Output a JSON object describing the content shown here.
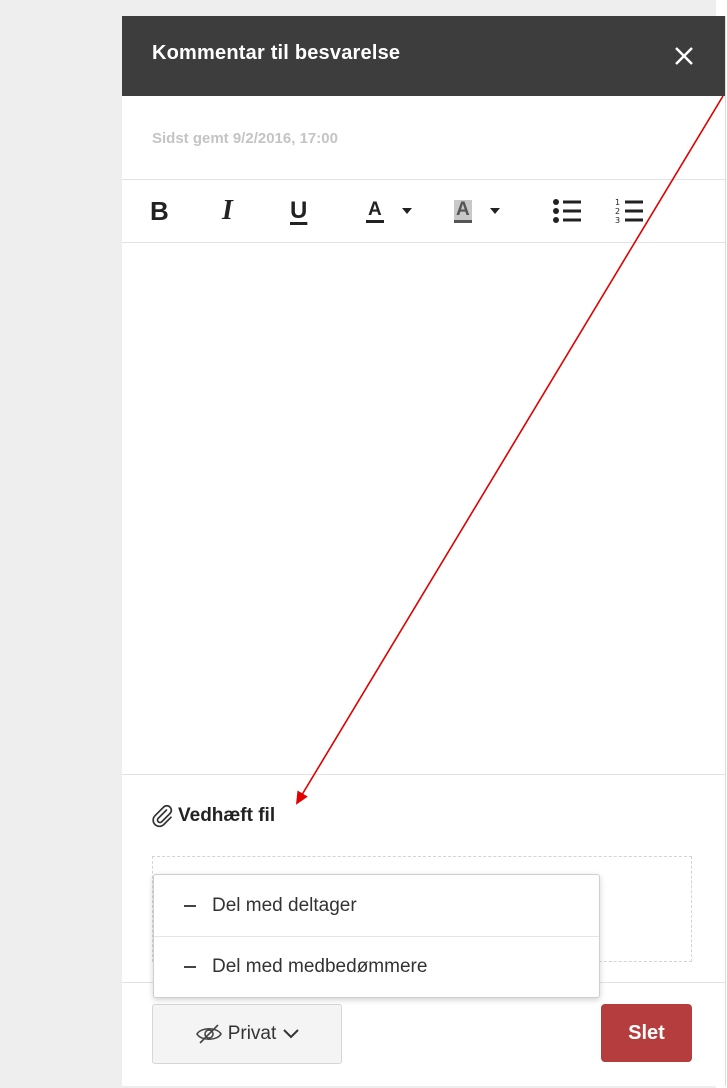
{
  "panel": {
    "title": "Kommentar til besvarelse",
    "saved_status": "Sidst gemt 9/2/2016, 17:00"
  },
  "toolbar": {
    "bold": "B",
    "italic": "I",
    "underline": "U",
    "text_color": "A",
    "highlight": "A"
  },
  "attachment": {
    "label": "Vedhæft fil"
  },
  "visibility_menu": {
    "options": [
      "Del med deltager",
      "Del med medbedømmere"
    ]
  },
  "footer": {
    "visibility_label": "Privat",
    "delete_label": "Slet"
  },
  "colors": {
    "header_bg": "#3d3d3d",
    "delete_button": "#b53d3d",
    "annotation_arrow": "#e00000"
  }
}
